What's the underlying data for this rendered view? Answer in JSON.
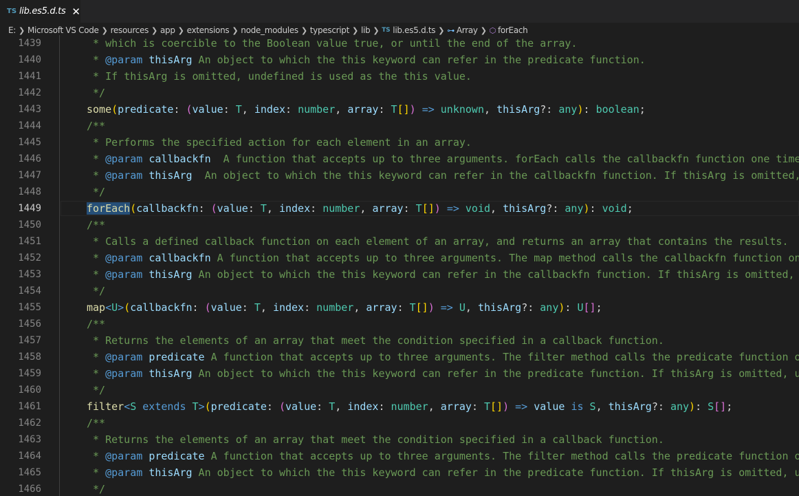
{
  "tab": {
    "lang_badge": "TS",
    "label": "lib.es5.d.ts",
    "close_glyph": "✕"
  },
  "breadcrumb": {
    "items": [
      "E:",
      "Microsoft VS Code",
      "resources",
      "app",
      "extensions",
      "node_modules",
      "typescript",
      "lib"
    ],
    "file_badge": "TS",
    "file": "lib.es5.d.ts",
    "symbol1": "Array",
    "symbol1_icon": "interface-icon",
    "symbol2": "forEach",
    "symbol2_icon": "method-icon"
  },
  "editor": {
    "active_line": "1449",
    "lines": [
      {
        "n": "1439",
        "segs": [
          [
            " * which is coercible to the Boolean value true, or until the end of the array.",
            "com"
          ]
        ]
      },
      {
        "n": "1440",
        "segs": [
          [
            " * ",
            "com"
          ],
          [
            "@param",
            "tag"
          ],
          [
            " ",
            "com"
          ],
          [
            "thisArg",
            "var"
          ],
          [
            " An object to which the this keyword can refer in the predicate function.",
            "com"
          ]
        ]
      },
      {
        "n": "1441",
        "segs": [
          [
            " * If thisArg is omitted, undefined is used as the this value.",
            "com"
          ]
        ]
      },
      {
        "n": "1442",
        "segs": [
          [
            " */",
            "com"
          ]
        ]
      },
      {
        "n": "1443",
        "segs": [
          [
            "some",
            "fn"
          ],
          [
            "(",
            "br1"
          ],
          [
            "predicate",
            "var"
          ],
          [
            ": ",
            "punc"
          ],
          [
            "(",
            "br2"
          ],
          [
            "value",
            "var"
          ],
          [
            ": ",
            "punc"
          ],
          [
            "T",
            "type"
          ],
          [
            ", ",
            "punc"
          ],
          [
            "index",
            "var"
          ],
          [
            ": ",
            "punc"
          ],
          [
            "number",
            "type"
          ],
          [
            ", ",
            "punc"
          ],
          [
            "array",
            "var"
          ],
          [
            ": ",
            "punc"
          ],
          [
            "T",
            "type"
          ],
          [
            "[]",
            "br1"
          ],
          [
            ") ",
            "br2"
          ],
          [
            "=>",
            "kw"
          ],
          [
            " ",
            "punc"
          ],
          [
            "unknown",
            "type"
          ],
          [
            ", ",
            "punc"
          ],
          [
            "thisArg",
            "var"
          ],
          [
            "?: ",
            "punc"
          ],
          [
            "any",
            "type"
          ],
          [
            ")",
            "br1"
          ],
          [
            ": ",
            "punc"
          ],
          [
            "boolean",
            "type"
          ],
          [
            ";",
            "punc"
          ]
        ]
      },
      {
        "n": "1444",
        "segs": [
          [
            "/**",
            "com"
          ]
        ]
      },
      {
        "n": "1445",
        "segs": [
          [
            " * Performs the specified action for each element in an array.",
            "com"
          ]
        ]
      },
      {
        "n": "1446",
        "segs": [
          [
            " * ",
            "com"
          ],
          [
            "@param",
            "tag"
          ],
          [
            " ",
            "com"
          ],
          [
            "callbackfn",
            "var"
          ],
          [
            "  A function that accepts up to three arguments. forEach calls the callbackfn function one time for each element in the array.",
            "com"
          ]
        ]
      },
      {
        "n": "1447",
        "segs": [
          [
            " * ",
            "com"
          ],
          [
            "@param",
            "tag"
          ],
          [
            " ",
            "com"
          ],
          [
            "thisArg",
            "var"
          ],
          [
            "  An object to which the this keyword can refer in the callbackfn function. If thisArg is omitted, undefined is used as the this value.",
            "com"
          ]
        ]
      },
      {
        "n": "1448",
        "segs": [
          [
            " */",
            "com"
          ]
        ]
      },
      {
        "n": "1449",
        "segs": [
          [
            "forEach",
            "fn-hl"
          ],
          [
            "(",
            "br1"
          ],
          [
            "callbackfn",
            "var"
          ],
          [
            ": ",
            "punc"
          ],
          [
            "(",
            "br2"
          ],
          [
            "value",
            "var"
          ],
          [
            ": ",
            "punc"
          ],
          [
            "T",
            "type"
          ],
          [
            ", ",
            "punc"
          ],
          [
            "index",
            "var"
          ],
          [
            ": ",
            "punc"
          ],
          [
            "number",
            "type"
          ],
          [
            ", ",
            "punc"
          ],
          [
            "array",
            "var"
          ],
          [
            ": ",
            "punc"
          ],
          [
            "T",
            "type"
          ],
          [
            "[]",
            "br1"
          ],
          [
            ") ",
            "br2"
          ],
          [
            "=>",
            "kw"
          ],
          [
            " ",
            "punc"
          ],
          [
            "void",
            "type"
          ],
          [
            ", ",
            "punc"
          ],
          [
            "thisArg",
            "var"
          ],
          [
            "?: ",
            "punc"
          ],
          [
            "any",
            "type"
          ],
          [
            ")",
            "br1"
          ],
          [
            ": ",
            "punc"
          ],
          [
            "void",
            "type"
          ],
          [
            ";",
            "punc"
          ]
        ]
      },
      {
        "n": "1450",
        "segs": [
          [
            "/**",
            "com"
          ]
        ]
      },
      {
        "n": "1451",
        "segs": [
          [
            " * Calls a defined callback function on each element of an array, and returns an array that contains the results.",
            "com"
          ]
        ]
      },
      {
        "n": "1452",
        "segs": [
          [
            " * ",
            "com"
          ],
          [
            "@param",
            "tag"
          ],
          [
            " ",
            "com"
          ],
          [
            "callbackfn",
            "var"
          ],
          [
            " A function that accepts up to three arguments. The map method calls the callbackfn function one time for each element in the array.",
            "com"
          ]
        ]
      },
      {
        "n": "1453",
        "segs": [
          [
            " * ",
            "com"
          ],
          [
            "@param",
            "tag"
          ],
          [
            " ",
            "com"
          ],
          [
            "thisArg",
            "var"
          ],
          [
            " An object to which the this keyword can refer in the callbackfn function. If thisArg is omitted, undefined is used as the this value.",
            "com"
          ]
        ]
      },
      {
        "n": "1454",
        "segs": [
          [
            " */",
            "com"
          ]
        ]
      },
      {
        "n": "1455",
        "segs": [
          [
            "map",
            "fn"
          ],
          [
            "<",
            "kw"
          ],
          [
            "U",
            "type"
          ],
          [
            ">",
            "kw"
          ],
          [
            "(",
            "br1"
          ],
          [
            "callbackfn",
            "var"
          ],
          [
            ": ",
            "punc"
          ],
          [
            "(",
            "br2"
          ],
          [
            "value",
            "var"
          ],
          [
            ": ",
            "punc"
          ],
          [
            "T",
            "type"
          ],
          [
            ", ",
            "punc"
          ],
          [
            "index",
            "var"
          ],
          [
            ": ",
            "punc"
          ],
          [
            "number",
            "type"
          ],
          [
            ", ",
            "punc"
          ],
          [
            "array",
            "var"
          ],
          [
            ": ",
            "punc"
          ],
          [
            "T",
            "type"
          ],
          [
            "[]",
            "br1"
          ],
          [
            ") ",
            "br2"
          ],
          [
            "=>",
            "kw"
          ],
          [
            " ",
            "punc"
          ],
          [
            "U",
            "type"
          ],
          [
            ", ",
            "punc"
          ],
          [
            "thisArg",
            "var"
          ],
          [
            "?: ",
            "punc"
          ],
          [
            "any",
            "type"
          ],
          [
            ")",
            "br1"
          ],
          [
            ": ",
            "punc"
          ],
          [
            "U",
            "type"
          ],
          [
            "[]",
            "br2"
          ],
          [
            ";",
            "punc"
          ]
        ]
      },
      {
        "n": "1456",
        "segs": [
          [
            "/**",
            "com"
          ]
        ]
      },
      {
        "n": "1457",
        "segs": [
          [
            " * Returns the elements of an array that meet the condition specified in a callback function.",
            "com"
          ]
        ]
      },
      {
        "n": "1458",
        "segs": [
          [
            " * ",
            "com"
          ],
          [
            "@param",
            "tag"
          ],
          [
            " ",
            "com"
          ],
          [
            "predicate",
            "var"
          ],
          [
            " A function that accepts up to three arguments. The filter method calls the predicate function one time for each element in the array.",
            "com"
          ]
        ]
      },
      {
        "n": "1459",
        "segs": [
          [
            " * ",
            "com"
          ],
          [
            "@param",
            "tag"
          ],
          [
            " ",
            "com"
          ],
          [
            "thisArg",
            "var"
          ],
          [
            " An object to which the this keyword can refer in the predicate function. If thisArg is omitted, undefined is used as the this value.",
            "com"
          ]
        ]
      },
      {
        "n": "1460",
        "segs": [
          [
            " */",
            "com"
          ]
        ]
      },
      {
        "n": "1461",
        "segs": [
          [
            "filter",
            "fn"
          ],
          [
            "<",
            "kw"
          ],
          [
            "S",
            "type"
          ],
          [
            " ",
            "punc"
          ],
          [
            "extends",
            "kw"
          ],
          [
            " ",
            "punc"
          ],
          [
            "T",
            "type"
          ],
          [
            ">",
            "kw"
          ],
          [
            "(",
            "br1"
          ],
          [
            "predicate",
            "var"
          ],
          [
            ": ",
            "punc"
          ],
          [
            "(",
            "br2"
          ],
          [
            "value",
            "var"
          ],
          [
            ": ",
            "punc"
          ],
          [
            "T",
            "type"
          ],
          [
            ", ",
            "punc"
          ],
          [
            "index",
            "var"
          ],
          [
            ": ",
            "punc"
          ],
          [
            "number",
            "type"
          ],
          [
            ", ",
            "punc"
          ],
          [
            "array",
            "var"
          ],
          [
            ": ",
            "punc"
          ],
          [
            "T",
            "type"
          ],
          [
            "[]",
            "br1"
          ],
          [
            ") ",
            "br2"
          ],
          [
            "=>",
            "kw"
          ],
          [
            " ",
            "punc"
          ],
          [
            "value",
            "var"
          ],
          [
            " ",
            "punc"
          ],
          [
            "is",
            "kw"
          ],
          [
            " ",
            "punc"
          ],
          [
            "S",
            "type"
          ],
          [
            ", ",
            "punc"
          ],
          [
            "thisArg",
            "var"
          ],
          [
            "?: ",
            "punc"
          ],
          [
            "any",
            "type"
          ],
          [
            ")",
            "br1"
          ],
          [
            ": ",
            "punc"
          ],
          [
            "S",
            "type"
          ],
          [
            "[]",
            "br2"
          ],
          [
            ";",
            "punc"
          ]
        ]
      },
      {
        "n": "1462",
        "segs": [
          [
            "/**",
            "com"
          ]
        ]
      },
      {
        "n": "1463",
        "segs": [
          [
            " * Returns the elements of an array that meet the condition specified in a callback function.",
            "com"
          ]
        ]
      },
      {
        "n": "1464",
        "segs": [
          [
            " * ",
            "com"
          ],
          [
            "@param",
            "tag"
          ],
          [
            " ",
            "com"
          ],
          [
            "predicate",
            "var"
          ],
          [
            " A function that accepts up to three arguments. The filter method calls the predicate function one time for each element in the array.",
            "com"
          ]
        ]
      },
      {
        "n": "1465",
        "segs": [
          [
            " * ",
            "com"
          ],
          [
            "@param",
            "tag"
          ],
          [
            " ",
            "com"
          ],
          [
            "thisArg",
            "var"
          ],
          [
            " An object to which the this keyword can refer in the predicate function. If thisArg is omitted, undefined is used as the this value.",
            "com"
          ]
        ]
      },
      {
        "n": "1466",
        "segs": [
          [
            " */",
            "com"
          ]
        ]
      }
    ]
  },
  "colors": {
    "comment": "#6a9955",
    "function": "#dcdcaa",
    "variable": "#9cdcfe",
    "type": "#4ec9b0",
    "keyword": "#569cd6",
    "selection": "#264f78"
  }
}
